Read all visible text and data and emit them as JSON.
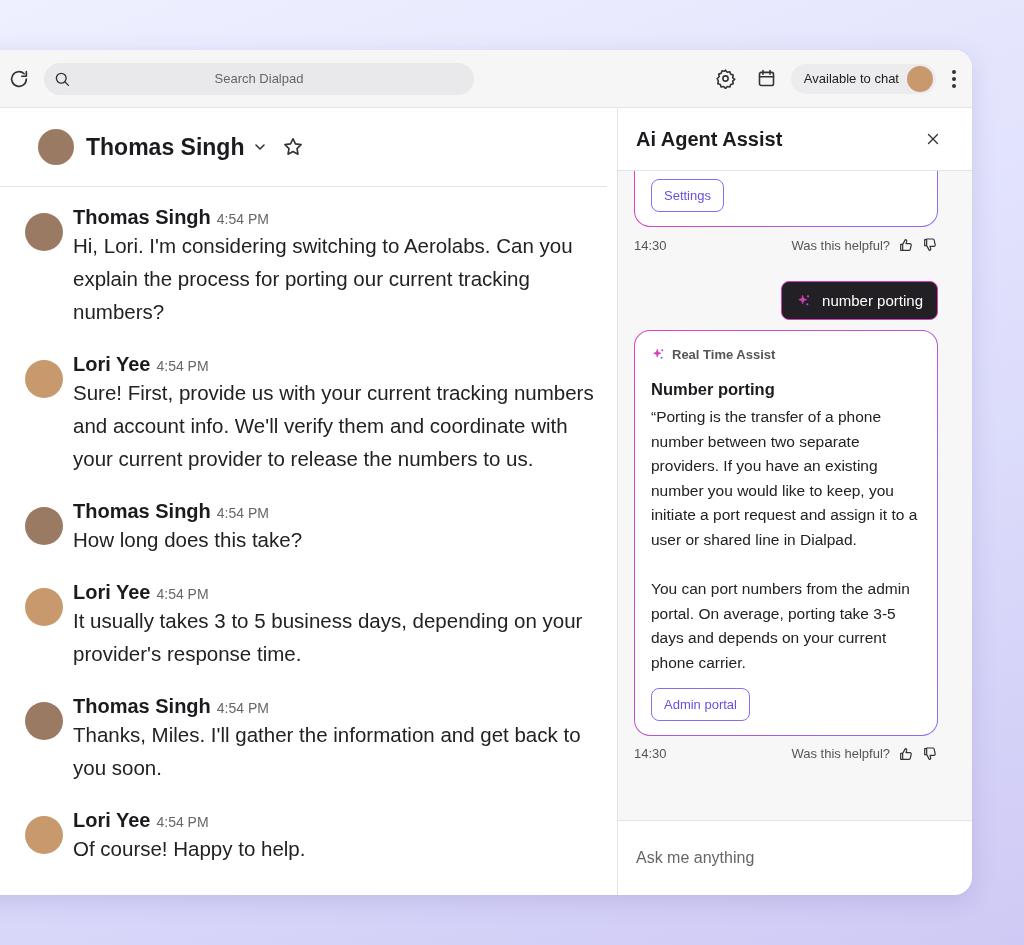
{
  "toolbar": {
    "search": {
      "placeholder": "Search Dialpad"
    },
    "status": "Available to chat"
  },
  "contact": {
    "name": "Thomas Singh"
  },
  "messages": [
    {
      "sender": "Thomas Singh",
      "time": "4:54 PM",
      "text": "Hi, Lori. I'm considering switching to Aerolabs. Can you explain the process for porting our current tracking numbers?"
    },
    {
      "sender": "Lori Yee",
      "time": "4:54 PM",
      "text": "Sure! First, provide us with your current tracking numbers and account info. We'll verify them and coordinate with your current provider to release the numbers to us."
    },
    {
      "sender": "Thomas Singh",
      "time": "4:54 PM",
      "text": "How long does this take?"
    },
    {
      "sender": "Lori Yee",
      "time": "4:54 PM",
      "text": "It usually takes 3 to 5 business days, depending on your provider's response time."
    },
    {
      "sender": "Thomas Singh",
      "time": "4:54 PM",
      "text": "Thanks, Miles. I'll gather the information and get back to you soon."
    },
    {
      "sender": "Lori Yee",
      "time": "4:54 PM",
      "text": "Of course! Happy to help."
    }
  ],
  "assist": {
    "title": "Ai Agent Assist",
    "feed": [
      {
        "kind": "card",
        "button": "Settings",
        "time": "14:30",
        "feedback": "Was this helpful?"
      },
      {
        "kind": "query",
        "text": "number porting"
      },
      {
        "kind": "card",
        "label": "Real Time Assist",
        "heading": "Number porting",
        "paragraphs": [
          "“Porting is the transfer of a phone number between two separate providers. If you have an existing number you would like to keep, you initiate a port request and assign it to a user or shared line in Dialpad.",
          "You can port numbers from the admin portal. On average, porting take 3-5 days and depends on your current phone carrier."
        ],
        "button": "Admin portal",
        "time": "14:30",
        "feedback": "Was this helpful?"
      }
    ],
    "input": {
      "placeholder": "Ask me anything"
    }
  }
}
